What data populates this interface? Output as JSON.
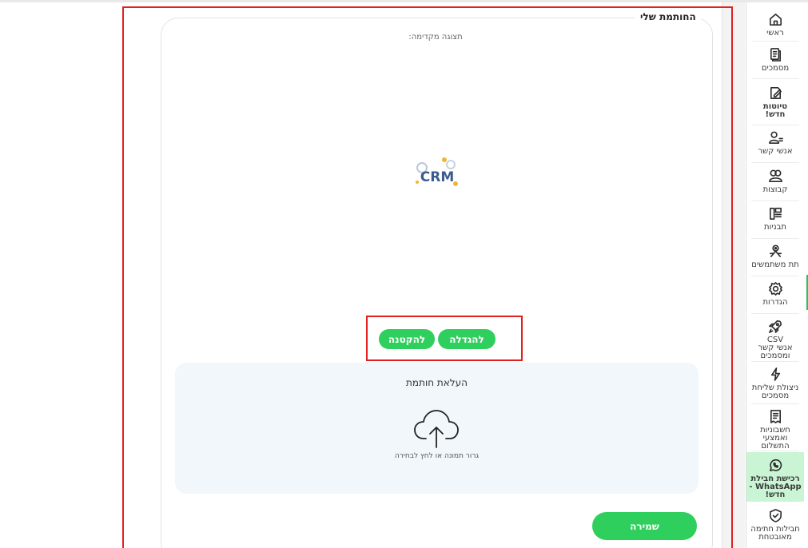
{
  "page": {
    "section_title": "החותמת שלי",
    "preview_label": "תצוגה מקדימה:",
    "logo_text": "CRM"
  },
  "size_controls": {
    "enlarge_label": "להגדלה",
    "shrink_label": "להקטנה"
  },
  "upload": {
    "title": "העלאת חותמת",
    "hint": "גרור תמונה או לחץ לבחירה"
  },
  "save_label": "שמירה",
  "sidebar": {
    "items": [
      {
        "label": "ראשי",
        "icon": "home-icon"
      },
      {
        "label": "מסמכים",
        "icon": "documents-icon"
      },
      {
        "label": "טיוטות\nחדש!",
        "icon": "drafts-icon"
      },
      {
        "label": "אנשי קשר",
        "icon": "contacts-icon"
      },
      {
        "label": "קבוצות",
        "icon": "groups-icon"
      },
      {
        "label": "תבניות",
        "icon": "templates-icon"
      },
      {
        "label": "תת משתמשים",
        "icon": "sub-users-icon"
      },
      {
        "label": "הגדרות",
        "icon": "settings-icon"
      },
      {
        "label": "CSV\nאנשי קשר\nומסמכים",
        "icon": "rocket-icon"
      },
      {
        "label": "ניצולת שליחת\nמסמכים",
        "icon": "bolt-icon"
      },
      {
        "label": "חשבוניות\nואמצעי\nהתשלום",
        "icon": "invoice-icon"
      },
      {
        "label": "רכישת חבילת\nWhatsApp -\nחדש!",
        "icon": "whatsapp-icon"
      },
      {
        "label": "חבילות חתימה\nמאובטחת",
        "icon": "shield-icon"
      }
    ]
  },
  "colors": {
    "accent_green": "#2fcf5d",
    "whatsapp_bg": "#c9f5d4",
    "highlight_red": "#e1201f",
    "upload_bg": "#f2f7fc"
  }
}
